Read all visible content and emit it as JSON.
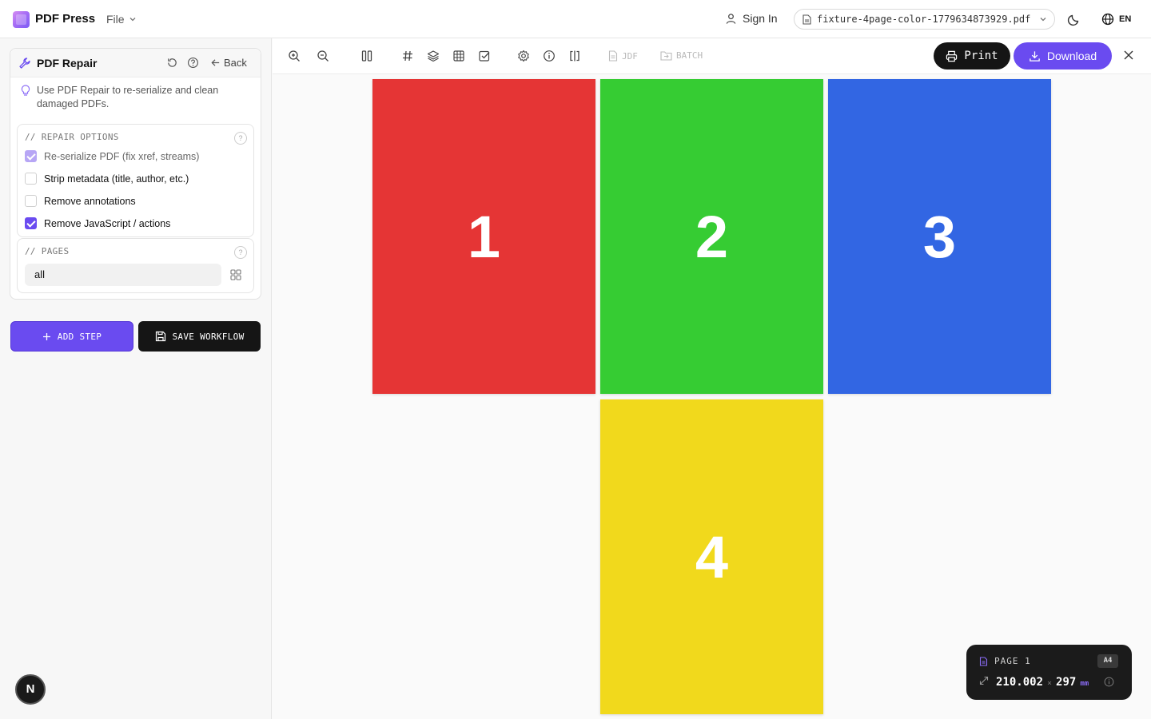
{
  "header": {
    "brand": "PDF Press",
    "file_menu": "File",
    "sign_in": "Sign In",
    "file_name": "fixture-4page-color-1779634873929.pdf",
    "language": "EN"
  },
  "sidebar": {
    "panel_title": "PDF Repair",
    "back_label": "Back",
    "hint": "Use PDF Repair to re-serialize and clean damaged PDFs.",
    "repair_options": {
      "title": "// REPAIR OPTIONS",
      "options": [
        {
          "label": "Re-serialize PDF (fix xref, streams)",
          "checked": true,
          "disabled": true
        },
        {
          "label": "Strip metadata (title, author, etc.)",
          "checked": false
        },
        {
          "label": "Remove annotations",
          "checked": false
        },
        {
          "label": "Remove JavaScript / actions",
          "checked": true
        }
      ]
    },
    "pages": {
      "title": "// PAGES",
      "value": "all"
    },
    "add_step_label": "ADD STEP",
    "save_workflow_label": "SAVE WORKFLOW",
    "badge": "N"
  },
  "toolbar": {
    "jdf_label": "JDF",
    "batch_label": "BATCH",
    "print_label": "Print",
    "download_label": "Download"
  },
  "pages": [
    {
      "number": "1",
      "color": "#e53535"
    },
    {
      "number": "2",
      "color": "#36cc33"
    },
    {
      "number": "3",
      "color": "#3266e3"
    },
    {
      "number": "4",
      "color": "#f1d91c"
    }
  ],
  "page_info": {
    "label": "PAGE 1",
    "size": "A4",
    "width": "210.002",
    "height": "297",
    "times": "×",
    "unit": "mm"
  },
  "colors": {
    "accent": "#6a4bf0",
    "dark": "#151515"
  }
}
